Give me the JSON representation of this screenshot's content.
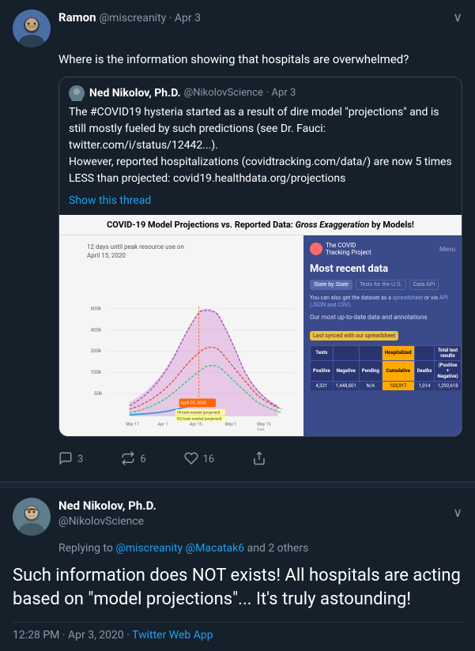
{
  "colors": {
    "background": "#15202b",
    "tweet_border": "#253341",
    "blue": "#1da1f2",
    "text_secondary": "#8899a6",
    "divider_bg": "#192734",
    "chart_bg": "#3b4a8a"
  },
  "tweet1": {
    "user": {
      "name": "Ramon",
      "handle": "@miscreanity",
      "date": "Apr 3"
    },
    "text": "Where is the information showing that hospitals are overwhelmed?",
    "quoted": {
      "user": {
        "name": "Ned Nikolov, Ph.D.",
        "handle": "@NikolovScience",
        "date": "Apr 3"
      },
      "text": "The #COVID19 hysteria started as a result of dire model \"projections\" and is still mostly fueled by such predictions (see Dr. Fauci: twitter.com/i/status/12442...).\nHowever, reported hospitalizations (covidtracking.com/data/) are now 5 times LESS than projected: covid19.healthdata.org/projections",
      "show_thread": "Show this thread"
    },
    "chart": {
      "title": "COVID-19 Model Projections vs. Reported Data: ",
      "title_italic": "Gross Exaggeration",
      "title_end": " by Models!",
      "label_days": "12 days until peak resource use on",
      "label_date": "April 15, 2020",
      "right_panel": {
        "logo_text1": "The COVID",
        "logo_text2": "Tracking Project",
        "menu": "Menu",
        "heading": "Most recent data",
        "tabs": [
          "State by State",
          "Tests for the U.S.",
          "Data API"
        ],
        "description": "You can also get the dataset as a spreadsheet or via API (JSON and CSV).",
        "our_data": "Our most up-to-date data and annotations",
        "last_synced": "Last synced with our spreadsheet",
        "table_headers": [
          "Tests",
          "",
          "",
          "Hospitalized",
          "",
          "Total test results"
        ],
        "table_sub_headers": [
          "Positive",
          "Negative",
          "Pending",
          "Cumulative",
          "Deaths",
          "(Positive + Negative)"
        ],
        "table_values": [
          "4,321",
          "1,448,601",
          "N/A",
          "103,917",
          "1,014",
          "1,292,618"
        ]
      }
    },
    "actions": {
      "reply": "3",
      "retweet": "6",
      "like": "16",
      "share": ""
    },
    "chevron": "∨"
  },
  "tweet2": {
    "user": {
      "name": "Ned Nikolov, Ph.D.",
      "handle": "@NikolovScience"
    },
    "reply_to": "Replying to @miscreanity @Macatak6 and 2 others",
    "main_text": "Such information does NOT exists! All hospitals are acting based on \"model projections\"... It's truly astounding!",
    "timestamp": "12:28 PM · Apr 3, 2020 · Twitter Web App",
    "chevron": "∨"
  },
  "icons": {
    "reply": "💬",
    "retweet": "🔁",
    "like": "🤍",
    "share": "📤"
  }
}
